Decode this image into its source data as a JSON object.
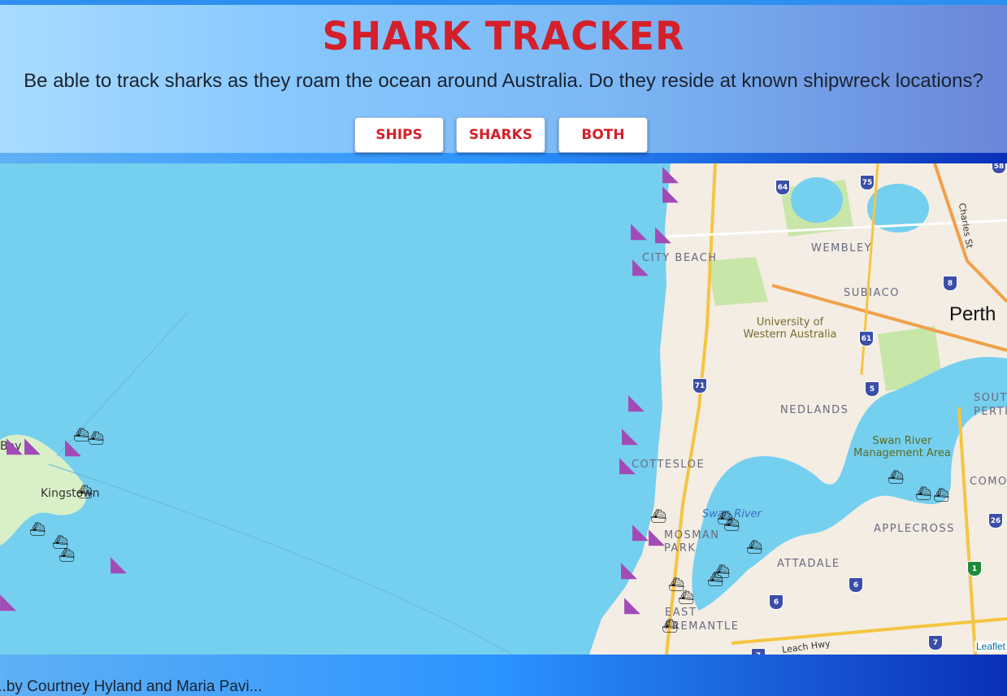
{
  "header": {
    "title": "SHARK TRACKER",
    "subtitle": "Be able to track sharks as they roam the ocean around Australia. Do they reside at known shipwreck locations?",
    "buttons": [
      "SHIPS",
      "SHARKS",
      "BOTH"
    ]
  },
  "map": {
    "labels": {
      "city": "Perth",
      "wembley": "WEMBLEY",
      "city_beach": "CITY BEACH",
      "subiaco": "SUBIACO",
      "uwa": "University of Western Australia",
      "nedlands": "NEDLANDS",
      "south_perth": "SOUTH PERTH",
      "swan_river_area": "Swan River Management Area",
      "cottesloe": "COTTESLOE",
      "como": "COMO",
      "swan_river": "Swan River",
      "mosman_park": "MOSMAN PARK",
      "applecross": "APPLECROSS",
      "attadale": "ATTADALE",
      "east_fremantle": "EAST FREMANTLE",
      "kingstown": "Kingstown",
      "bay": "Bay",
      "charles_st": "Charles St",
      "leach_hwy": "Leach Hwy"
    },
    "road_shields": [
      "64",
      "75",
      "58",
      "8",
      "61",
      "71",
      "5",
      "26",
      "1",
      "6",
      "6",
      "7",
      "7"
    ],
    "attribution": "Leaflet",
    "marker_icons": {
      "shark": "shark-fin-icon",
      "ship": "ship-icon"
    },
    "colors": {
      "shark": "#a24bb7",
      "water": "#75cfef",
      "title": "#d4202b"
    }
  },
  "footer": {
    "text": "...by Courtney Hyland and Maria Pavi..."
  }
}
